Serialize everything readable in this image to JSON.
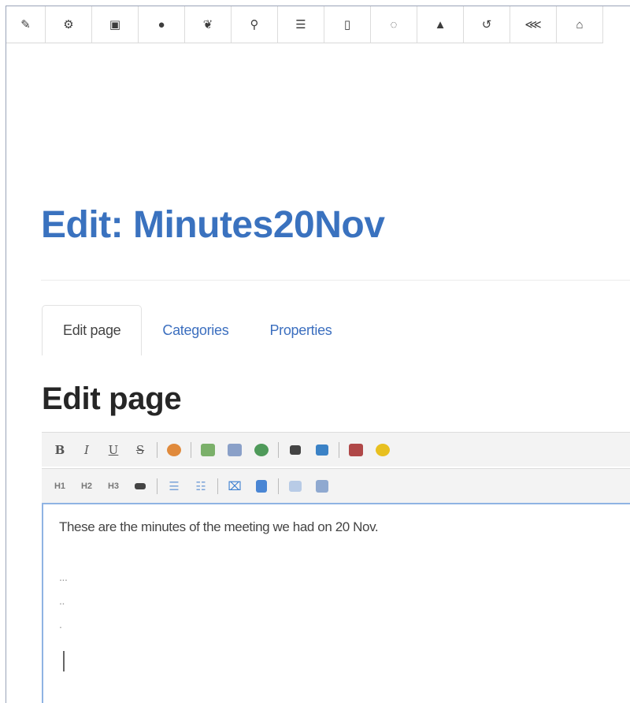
{
  "top_toolbar": {
    "icons": [
      "pencil-icon",
      "gear-icon",
      "image-icon",
      "user-icon",
      "users-icon",
      "wrench-icon",
      "list-icon",
      "clipboard-icon",
      "spinner-icon",
      "warning-icon",
      "undo-icon",
      "share-icon",
      "home-icon"
    ]
  },
  "page": {
    "title": "Edit: Minutes20Nov",
    "section_title": "Edit page"
  },
  "tabs": [
    {
      "label": "Edit page",
      "active": true
    },
    {
      "label": "Categories",
      "active": false
    },
    {
      "label": "Properties",
      "active": false
    }
  ],
  "editor_toolbar": {
    "row1": {
      "bold": "B",
      "italic": "I",
      "underline": "U",
      "strike": "S"
    },
    "row2": {
      "h1": "H1",
      "h2": "H2",
      "h3": "H3"
    }
  },
  "editor": {
    "line1": "These are the minutes of the meeting we had on 20 Nov.",
    "line2": "...",
    "line3": "..",
    "line4": "."
  }
}
